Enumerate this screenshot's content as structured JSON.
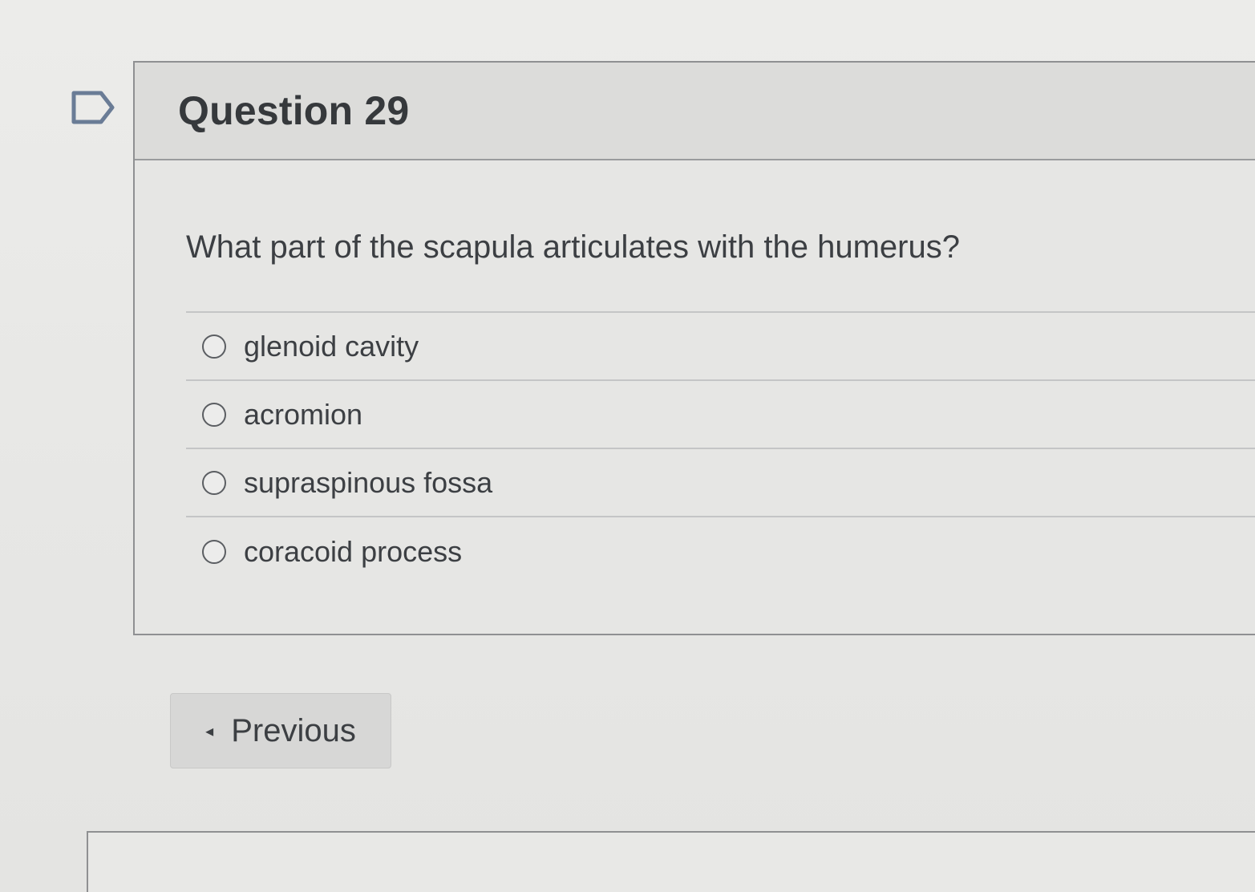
{
  "question": {
    "flag_icon": "flag-outline-icon",
    "title": "Question 29",
    "text": "What part of the scapula articulates with the humerus?",
    "answers": [
      {
        "label": "glenoid cavity"
      },
      {
        "label": "acromion"
      },
      {
        "label": "supraspinous fossa"
      },
      {
        "label": "coracoid process"
      }
    ]
  },
  "navigation": {
    "previous_icon": "caret-left-icon",
    "previous_arrow": "◂",
    "previous_label": "Previous"
  }
}
